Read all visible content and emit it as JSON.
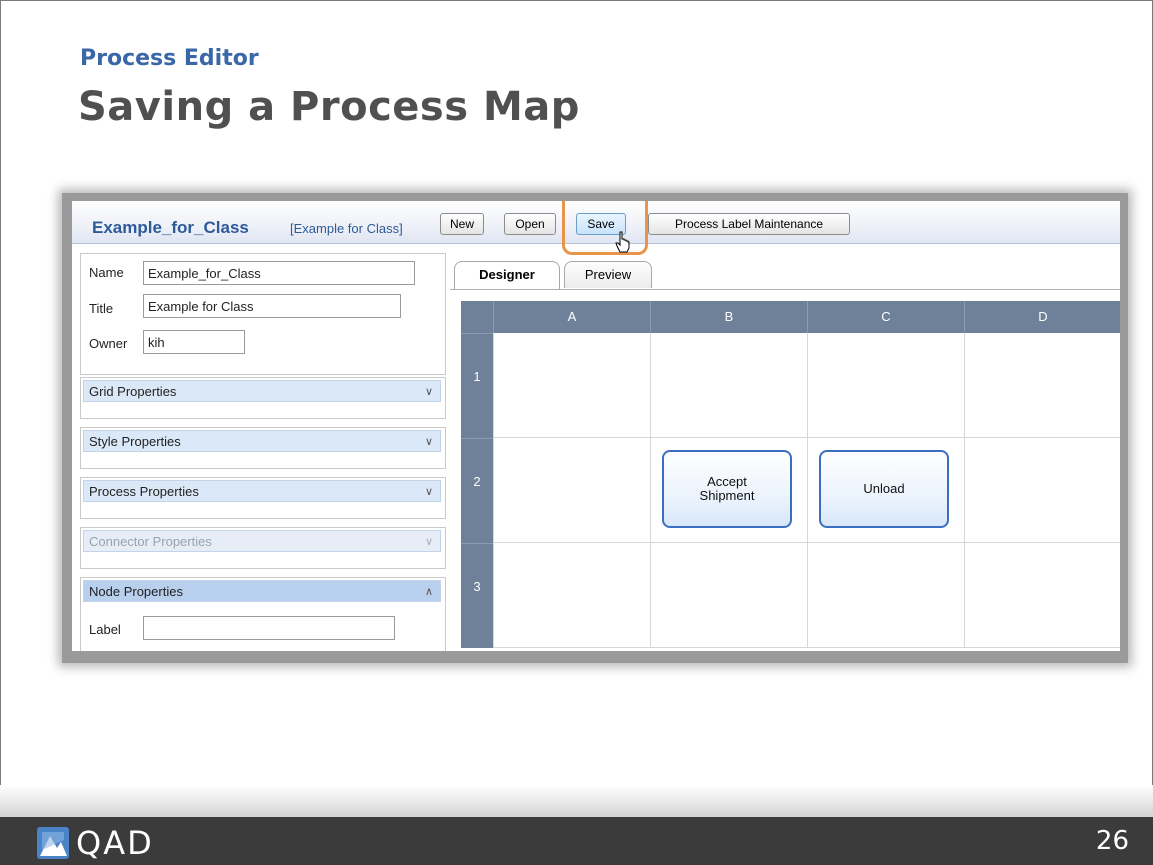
{
  "slide": {
    "eyebrow": "Process Editor",
    "title": "Saving a Process Map",
    "page_number": "26",
    "logo_text": "QAD"
  },
  "app": {
    "title": "Example_for_Class",
    "subtitle": "[Example for Class]",
    "buttons": {
      "new": "New",
      "open": "Open",
      "save": "Save",
      "label_maint": "Process Label Maintenance"
    },
    "highlight_color": "#e8944a"
  },
  "form": {
    "name_label": "Name",
    "name_value": "Example_for_Class",
    "title_label": "Title",
    "title_value": "Example for Class",
    "owner_label": "Owner",
    "owner_value": "kih",
    "node_label": "Label",
    "node_label_value": ""
  },
  "properties": [
    {
      "label": "Grid Properties",
      "state": "collapsed"
    },
    {
      "label": "Style Properties",
      "state": "collapsed"
    },
    {
      "label": "Process Properties",
      "state": "collapsed"
    },
    {
      "label": "Connector Properties",
      "state": "disabled"
    },
    {
      "label": "Node Properties",
      "state": "expanded"
    }
  ],
  "tabs": {
    "designer": "Designer",
    "preview": "Preview"
  },
  "grid": {
    "columns": [
      "A",
      "B",
      "C",
      "D"
    ],
    "rows": [
      "1",
      "2",
      "3"
    ],
    "nodes": [
      {
        "label": "Accept\nShipment",
        "row": "2",
        "col": "B"
      },
      {
        "label": "Unload",
        "row": "2",
        "col": "C"
      }
    ],
    "header_color": "#6e8199",
    "node_border_color": "#3a6fc0"
  }
}
